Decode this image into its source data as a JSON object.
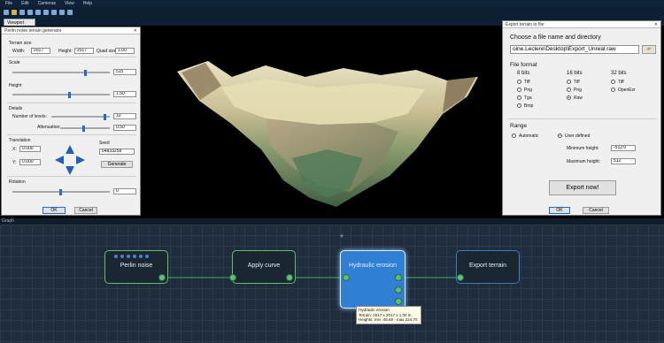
{
  "menu": [
    "File",
    "Edit",
    "Cameras",
    "View",
    "Help"
  ],
  "viewport_tab": "Viewport",
  "perlin_dialog": {
    "title": "Perlin noise terrain generator",
    "terrain_size_label": "Terrain size",
    "width_label": "Width:",
    "width_value": "2017",
    "height_label": "Height:",
    "height_value": "2017",
    "quad_size_label": "Quad size:",
    "quad_size_value": "1.00",
    "scale_label": "Scale",
    "scale_value": "515",
    "height_section_label": "Height",
    "height_scale_value": "1.50",
    "details_label": "Details",
    "number_of_levels_label": "Number of levels:",
    "number_of_levels_value": "10",
    "attenuation_label": "Attenuation:",
    "attenuation_value": "0.50",
    "translation_label": "Translation",
    "x_label": "X:",
    "x_value": "0.000",
    "y_label": "Y:",
    "y_value": "0.000",
    "seed_label": "Seed",
    "seed_value": "64833258",
    "generate_label": "Generate",
    "rotation_label": "Rotation",
    "rotation_value": "0",
    "ok_label": "OK",
    "cancel_label": "Cancel"
  },
  "export_dialog": {
    "title": "Export terrain to file",
    "choose_label": "Choose a file name and directory",
    "path_value": "oine.Leclere\\Desktop\\Export_Unreal.raw",
    "file_format_label": "File format",
    "bits8_label": "8 bits",
    "bits16_label": "16 bits",
    "bits32_label": "32 bits",
    "formats8": [
      "Tiff",
      "Png",
      "Tga",
      "Bmp"
    ],
    "formats16": [
      "Tiff",
      "Png",
      "Raw"
    ],
    "formats32": [
      "Tiff",
      "OpenExr"
    ],
    "range_label": "Range",
    "automatic_label": "Automatic",
    "user_defined_label": "User defined",
    "min_height_label": "Minimum height:",
    "min_height_value": "-512.0",
    "max_height_label": "Maximum height:",
    "max_height_value": "512",
    "export_now_label": "Export now!",
    "ok_label": "OK",
    "cancel_label": "Cancel"
  },
  "graph": {
    "header": "Graph",
    "nodes": {
      "perlin": "Perlin noise",
      "apply_curve": "Apply curve",
      "hydraulic": "Hydraulic erosion",
      "export": "Export terrain"
    },
    "tooltip": [
      "Hydraulic erosion",
      "Terrain: 2017 x 2017 x 1.00 m",
      "Heights: min -48.68 - max 224.70"
    ]
  }
}
